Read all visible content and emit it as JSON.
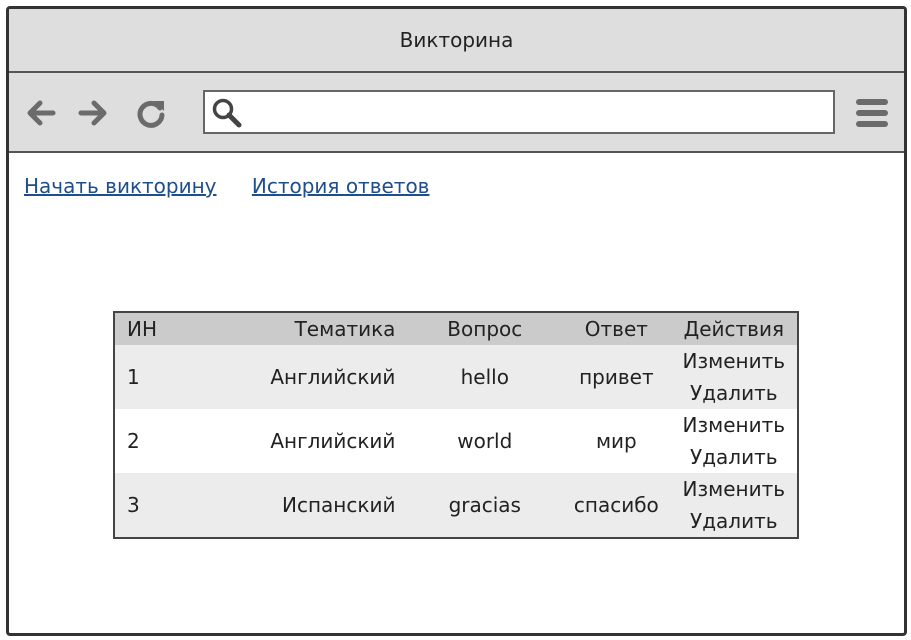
{
  "window": {
    "title": "Викторина"
  },
  "toolbar": {
    "back_icon": "arrow-left-icon",
    "forward_icon": "arrow-right-icon",
    "reload_icon": "reload-icon",
    "search_icon": "search-icon",
    "menu_icon": "hamburger-menu-icon",
    "url_value": "",
    "url_placeholder": ""
  },
  "links": {
    "start_quiz": "Начать викторину",
    "history": "История ответов"
  },
  "table": {
    "headers": [
      "ИН",
      "Тематика",
      "Вопрос",
      "Ответ",
      "Действия"
    ],
    "rows": [
      {
        "id": "1",
        "topic": "Английский",
        "question": "hello",
        "answer": "привет",
        "edit": "Изменить",
        "delete": "Удалить"
      },
      {
        "id": "2",
        "topic": "Английский",
        "question": "world",
        "answer": "мир",
        "edit": "Изменить",
        "delete": "Удалить"
      },
      {
        "id": "3",
        "topic": "Испанский",
        "question": "gracias",
        "answer": "спасибо",
        "edit": "Изменить",
        "delete": "Удалить"
      }
    ]
  },
  "colors": {
    "chrome_bg": "#dedede",
    "link": "#1f4e8c",
    "table_header_bg": "#cbcbcb",
    "row_alt_bg": "#ececec"
  }
}
